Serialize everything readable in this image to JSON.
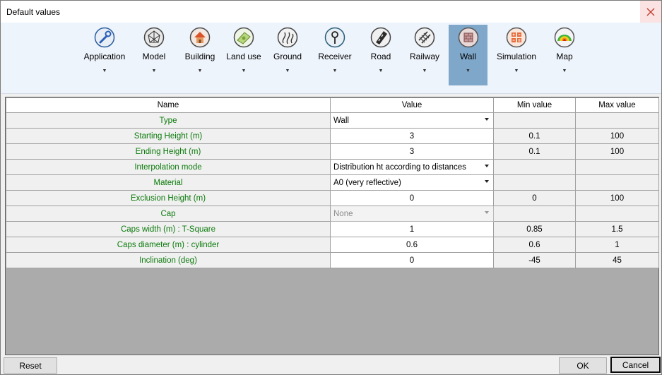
{
  "window": {
    "title": "Default values"
  },
  "ribbon": {
    "items": [
      {
        "label": "Application",
        "icon": "wrench-icon"
      },
      {
        "label": "Model",
        "icon": "mesh-icon"
      },
      {
        "label": "Building",
        "icon": "house-icon"
      },
      {
        "label": "Land use",
        "icon": "landuse-icon"
      },
      {
        "label": "Ground",
        "icon": "ground-icon"
      },
      {
        "label": "Receiver",
        "icon": "receiver-icon"
      },
      {
        "label": "Road",
        "icon": "road-icon"
      },
      {
        "label": "Railway",
        "icon": "railway-icon"
      },
      {
        "label": "Wall",
        "icon": "wall-icon"
      },
      {
        "label": "Simulation",
        "icon": "calculator-icon"
      },
      {
        "label": "Map",
        "icon": "heatmap-icon"
      }
    ],
    "active": "Wall",
    "dropdown_glyph": "▼"
  },
  "table": {
    "columns": [
      "Name",
      "Value",
      "Min value",
      "Max value"
    ],
    "rows": [
      {
        "name": "Type",
        "value": "Wall",
        "kind": "combo",
        "min": "",
        "max": ""
      },
      {
        "name": "Starting Height (m)",
        "value": "3",
        "kind": "text",
        "min": "0.1",
        "max": "100"
      },
      {
        "name": "Ending Height (m)",
        "value": "3",
        "kind": "text",
        "min": "0.1",
        "max": "100"
      },
      {
        "name": "Interpolation mode",
        "value": "Distribution ht according to distances",
        "kind": "combo",
        "min": "",
        "max": ""
      },
      {
        "name": "Material",
        "value": "A0 (very reflective)",
        "kind": "combo",
        "min": "",
        "max": ""
      },
      {
        "name": "Exclusion Height (m)",
        "value": "0",
        "kind": "text",
        "min": "0",
        "max": "100"
      },
      {
        "name": "Cap",
        "value": "None",
        "kind": "combo-disabled",
        "min": "",
        "max": ""
      },
      {
        "name": "Caps width (m) : T-Square",
        "value": "1",
        "kind": "text",
        "min": "0.85",
        "max": "1.5"
      },
      {
        "name": "Caps diameter (m) : cylinder",
        "value": "0.6",
        "kind": "text",
        "min": "0.6",
        "max": "1"
      },
      {
        "name": "Inclination (deg)",
        "value": "0",
        "kind": "text",
        "min": "-45",
        "max": "45"
      }
    ]
  },
  "footer": {
    "reset": "Reset",
    "ok": "OK",
    "cancel": "Cancel"
  },
  "colors": {
    "name_text": "#0b7a0b",
    "active_tab": "#7fa7c9",
    "ribbon_bg": "#eef4fc",
    "grid_empty": "#ababab"
  }
}
